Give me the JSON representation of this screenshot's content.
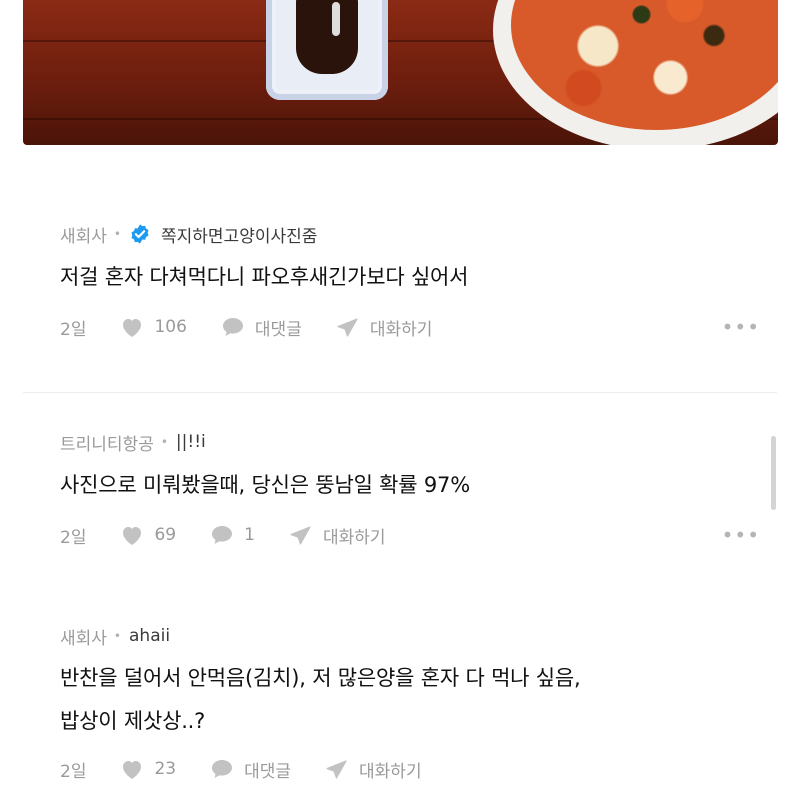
{
  "colors": {
    "icon_gray": "#b3b3b3",
    "verified_blue": "#1d9bf0",
    "text_gray": "#9a9a9a"
  },
  "comments": [
    {
      "group": "새회사",
      "author": "쪽지하면고양이사진줌",
      "verified": true,
      "text": "저걸 혼자 다쳐먹다니 파오후새긴가보다 싶어서",
      "time": "2일",
      "likes": "106",
      "reply_label": "대댓글",
      "chat_label": "대화하기",
      "more": "•••"
    },
    {
      "group": "트리니티항공",
      "author": "||!!i",
      "verified": false,
      "text": "사진으로 미뤄봤을때, 당신은 뚱남일 확률 97%",
      "time": "2일",
      "likes": "69",
      "reply_label": "1",
      "chat_label": "대화하기",
      "more": "•••"
    },
    {
      "group": "새회사",
      "author": "ahaii",
      "verified": false,
      "text_lines": [
        "반찬을 덜어서 안먹음(김치), 저 많은양을 혼자 다 먹나 싶음,",
        "밥상이 제삿상..?"
      ],
      "time": "2일",
      "likes": "23",
      "reply_label": "대댓글",
      "chat_label": "대화하기"
    }
  ],
  "icons": [
    "heart-icon",
    "speech-bubble-icon",
    "send-icon",
    "verified-badge-icon",
    "more-icon"
  ]
}
